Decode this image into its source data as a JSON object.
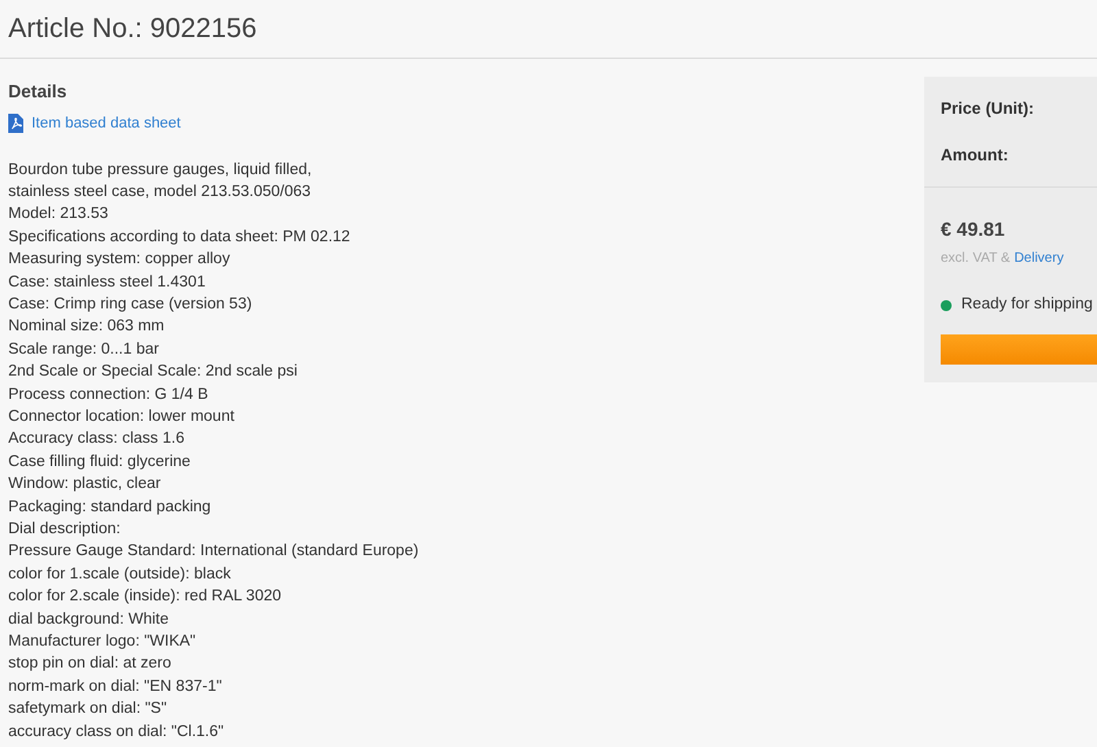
{
  "title": "Article No.: 9022156",
  "details": {
    "heading": "Details",
    "datasheet_link": "Item based data sheet",
    "lines": [
      "Bourdon tube pressure gauges, liquid filled,",
      "stainless steel case, model 213.53.050/063",
      "Model: 213.53",
      "Specifications according to data sheet: PM 02.12",
      "Measuring system: copper alloy",
      "Case: stainless steel 1.4301",
      "Case: Crimp ring case (version 53)",
      "Nominal size: 063 mm",
      "Scale range: 0...1 bar",
      "2nd Scale or Special Scale: 2nd scale psi",
      "Process connection: G 1/4 B",
      "Connector location: lower mount",
      "Accuracy class: class 1.6",
      "Case filling fluid: glycerine",
      "Window: plastic, clear",
      "Packaging: standard packing",
      "Dial description:",
      "Pressure Gauge Standard: International (standard Europe)",
      "color for 1.scale (outside): black",
      "color for 2.scale (inside): red RAL 3020",
      "dial background: White",
      "Manufacturer logo: \"WIKA\"",
      "stop pin on dial: at zero",
      "norm-mark on dial: \"EN 837-1\"",
      "safetymark on dial: \"S\"",
      "accuracy class on dial: \"Cl.1.6\""
    ]
  },
  "purchase": {
    "price_label": "Price (Unit):",
    "amount_label": "Amount:",
    "price": "€ 49.81",
    "tax_note": "excl. VAT &",
    "delivery_link": "Delivery",
    "availability": {
      "text": "Ready for shipping",
      "color": "#1a9e5c"
    }
  }
}
